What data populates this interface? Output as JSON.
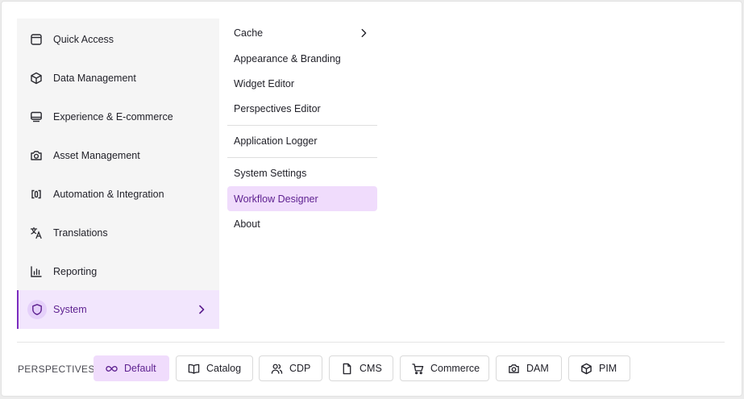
{
  "nav": {
    "items": [
      {
        "label": "Quick Access",
        "icon": "window-icon"
      },
      {
        "label": "Data Management",
        "icon": "cube-icon"
      },
      {
        "label": "Experience & E-commerce",
        "icon": "monitor-icon"
      },
      {
        "label": "Asset Management",
        "icon": "camera-icon"
      },
      {
        "label": "Automation & Integration",
        "icon": "integration-icon"
      },
      {
        "label": "Translations",
        "icon": "translate-icon"
      },
      {
        "label": "Reporting",
        "icon": "bar-chart-icon"
      },
      {
        "label": "System",
        "icon": "shield-icon",
        "active": true
      }
    ]
  },
  "submenu": {
    "items": [
      {
        "label": "Cache",
        "has_submenu": true
      },
      {
        "label": "Appearance & Branding"
      },
      {
        "label": "Widget Editor"
      },
      {
        "label": "Perspectives Editor"
      },
      {
        "label": "Application Logger"
      },
      {
        "label": "System Settings"
      },
      {
        "label": "Workflow Designer",
        "active": true
      },
      {
        "label": "About"
      }
    ]
  },
  "perspectives": {
    "label": "PERSPECTIVES",
    "items": [
      {
        "label": "Default",
        "icon": "infinity-icon",
        "active": true
      },
      {
        "label": "Catalog",
        "icon": "book-icon"
      },
      {
        "label": "CDP",
        "icon": "users-icon"
      },
      {
        "label": "CMS",
        "icon": "file-icon"
      },
      {
        "label": "Commerce",
        "icon": "cart-icon"
      },
      {
        "label": "DAM",
        "icon": "camera-icon"
      },
      {
        "label": "PIM",
        "icon": "box-icon"
      }
    ]
  },
  "colors": {
    "accent": "#7b2cbf",
    "active_bg": "#f0dcfc",
    "nav_bg": "#f5f5f5"
  }
}
